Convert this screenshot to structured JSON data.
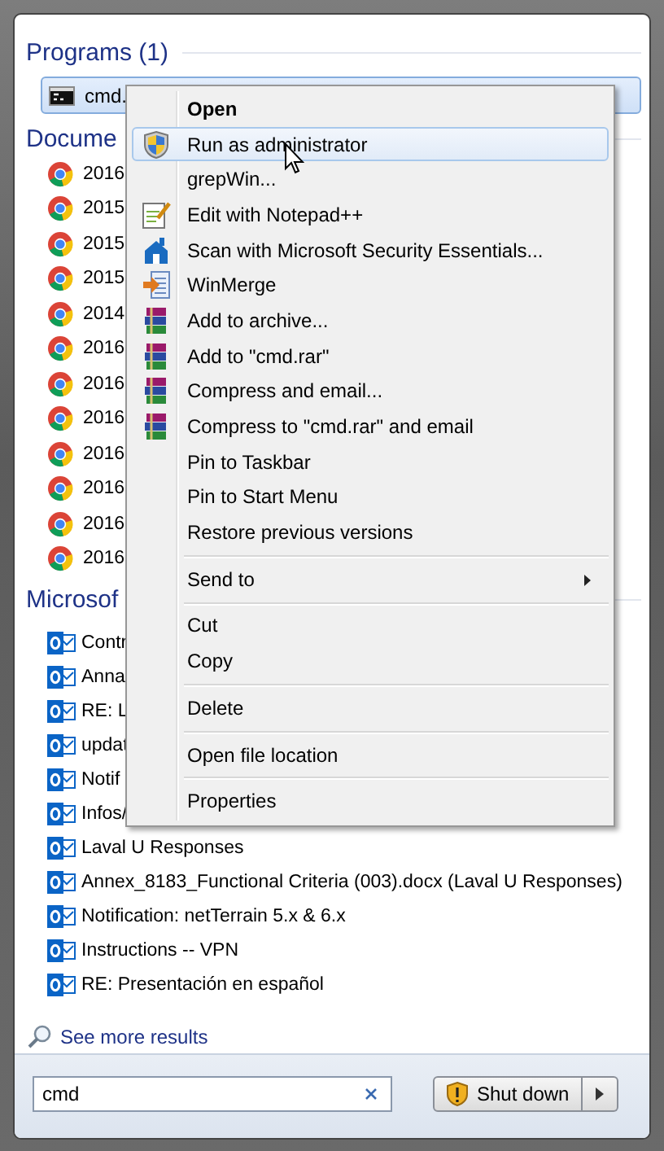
{
  "programs": {
    "title": "Programs (1)",
    "items": [
      {
        "label": "cmd.",
        "selected": true
      }
    ]
  },
  "documents": {
    "title": "Docume",
    "items": [
      {
        "label": "2016"
      },
      {
        "label": "2015"
      },
      {
        "label": "2015"
      },
      {
        "label": "2015"
      },
      {
        "label": "2014"
      },
      {
        "label": "2016"
      },
      {
        "label": "2016"
      },
      {
        "label": "2016"
      },
      {
        "label": "2016"
      },
      {
        "label": "2016"
      },
      {
        "label": "2016"
      },
      {
        "label": "2016"
      }
    ]
  },
  "messages": {
    "title": "Microsof",
    "items": [
      {
        "label": "Contr"
      },
      {
        "label": "Anna"
      },
      {
        "label": "RE: L"
      },
      {
        "label": "updat"
      },
      {
        "label": "Notif"
      },
      {
        "label": "Infos/"
      },
      {
        "label": "Laval U Responses"
      },
      {
        "label": "Annex_8183_Functional Criteria (003).docx (Laval U Responses)"
      },
      {
        "label": "Notification: netTerrain 5.x & 6.x"
      },
      {
        "label": "Instructions -- VPN"
      },
      {
        "label": "RE: Presentación en español"
      }
    ]
  },
  "see_more": "See more results",
  "search": {
    "value": "cmd"
  },
  "shutdown": {
    "label": "Shut down"
  },
  "context_menu": {
    "groups": [
      [
        {
          "label": "Open",
          "default": true,
          "selected": false,
          "submenu": false
        },
        {
          "label": "Run as administrator",
          "default": false,
          "selected": true,
          "submenu": false
        },
        {
          "label": "grepWin...",
          "default": false,
          "selected": false,
          "submenu": false
        },
        {
          "label": "Edit with Notepad++",
          "default": false,
          "selected": false,
          "submenu": false
        },
        {
          "label": "Scan with Microsoft Security Essentials...",
          "default": false,
          "selected": false,
          "submenu": false
        },
        {
          "label": "WinMerge",
          "default": false,
          "selected": false,
          "submenu": false
        },
        {
          "label": "Add to archive...",
          "default": false,
          "selected": false,
          "submenu": false
        },
        {
          "label": "Add to \"cmd.rar\"",
          "default": false,
          "selected": false,
          "submenu": false
        },
        {
          "label": "Compress and email...",
          "default": false,
          "selected": false,
          "submenu": false
        },
        {
          "label": "Compress to \"cmd.rar\" and email",
          "default": false,
          "selected": false,
          "submenu": false
        },
        {
          "label": "Pin to Taskbar",
          "default": false,
          "selected": false,
          "submenu": false
        },
        {
          "label": "Pin to Start Menu",
          "default": false,
          "selected": false,
          "submenu": false
        },
        {
          "label": "Restore previous versions",
          "default": false,
          "selected": false,
          "submenu": false
        }
      ],
      [
        {
          "label": "Send to",
          "default": false,
          "selected": false,
          "submenu": true
        }
      ],
      [
        {
          "label": "Cut",
          "default": false,
          "selected": false,
          "submenu": false
        },
        {
          "label": "Copy",
          "default": false,
          "selected": false,
          "submenu": false
        }
      ],
      [
        {
          "label": "Delete",
          "default": false,
          "selected": false,
          "submenu": false
        }
      ],
      [
        {
          "label": "Open file location",
          "default": false,
          "selected": false,
          "submenu": false
        }
      ],
      [
        {
          "label": "Properties",
          "default": false,
          "selected": false,
          "submenu": false
        }
      ]
    ]
  }
}
